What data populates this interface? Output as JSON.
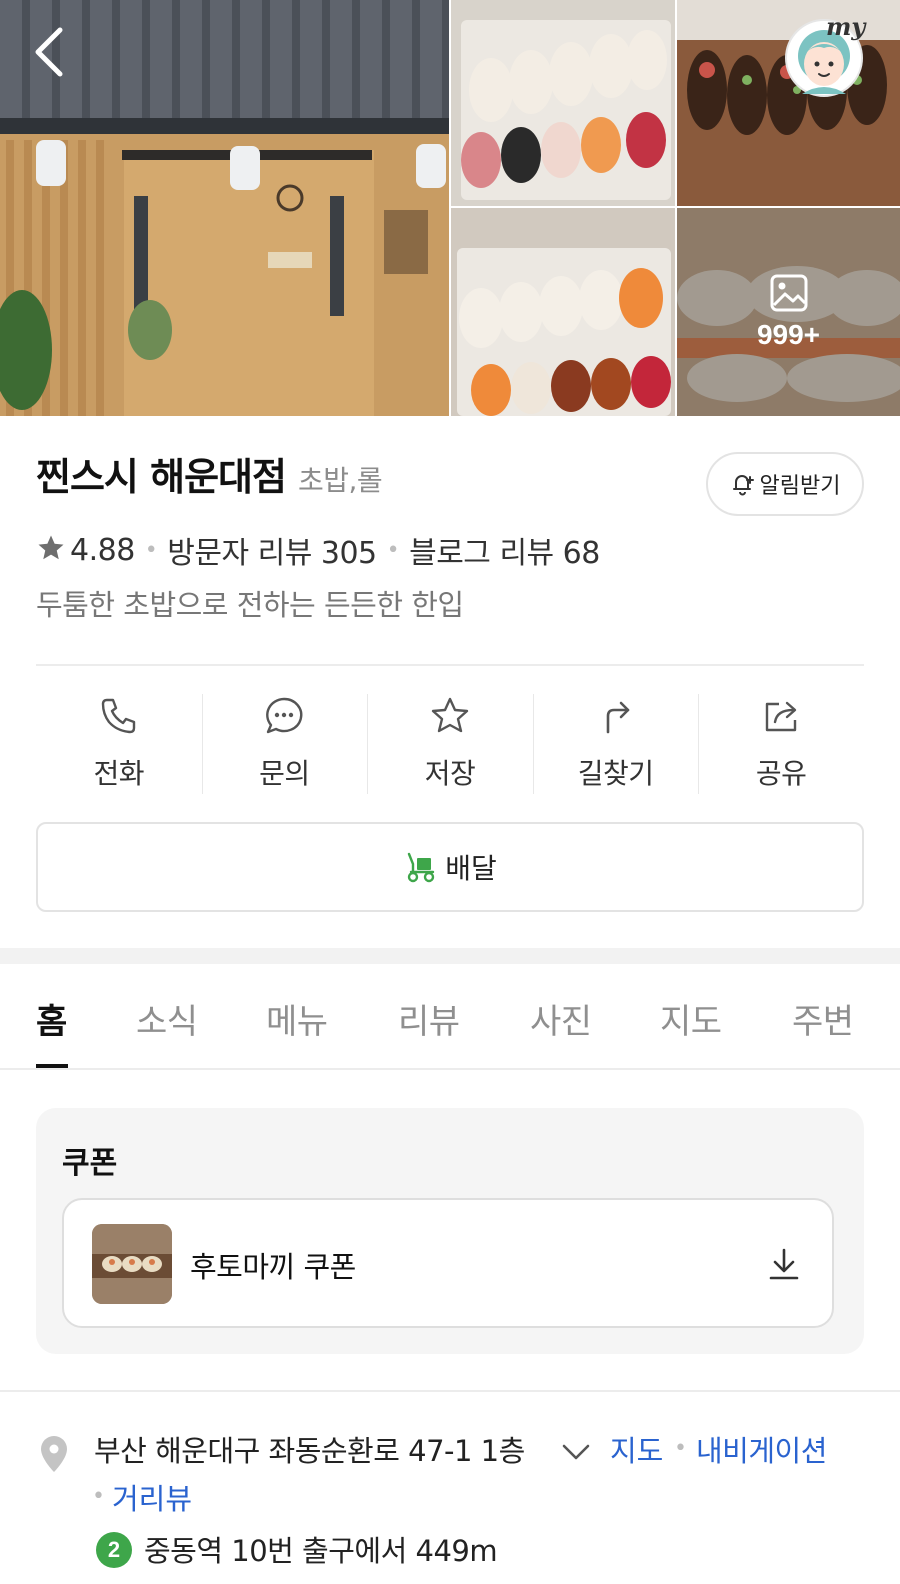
{
  "gallery": {
    "more_count": "999+",
    "photo_icons": [
      "storefront-photo",
      "sushi-photo",
      "grilled-eel-photo",
      "sushi-platter-photo",
      "torched-salmon-photo"
    ]
  },
  "header": {
    "back_icon": "back-arrow-icon",
    "my_icon": "my-avatar-icon",
    "my_badge": "my"
  },
  "place": {
    "name": "찐스시 해운대점",
    "category": "초밥,롤",
    "alarm_label": "알림받기",
    "rating": "4.88",
    "visitor_reviews": "방문자 리뷰 305",
    "blog_reviews": "블로그 리뷰 68",
    "tagline": "두툼한 초밥으로 전하는 든든한 한입"
  },
  "actions": [
    {
      "label": "전화",
      "icon": "phone-icon"
    },
    {
      "label": "문의",
      "icon": "chat-icon"
    },
    {
      "label": "저장",
      "icon": "star-icon"
    },
    {
      "label": "길찾기",
      "icon": "directions-icon"
    },
    {
      "label": "공유",
      "icon": "share-icon"
    }
  ],
  "delivery": {
    "label": "배달",
    "icon": "delivery-scooter-icon",
    "color": "#3ea64a"
  },
  "tabs": [
    "홈",
    "소식",
    "메뉴",
    "리뷰",
    "사진",
    "지도",
    "주변"
  ],
  "active_tab": "홈",
  "coupon": {
    "title": "쿠폰",
    "item_name": "후토마끼 쿠폰"
  },
  "address": {
    "text": "부산 해운대구 좌동순환로 47-1 1층",
    "map_link": "지도",
    "nav_link": "내비게이션",
    "street_link": "거리뷰",
    "subway_line": "2",
    "subway_info": "중동역 10번 출구에서 449m"
  },
  "colors": {
    "link": "#2a63cf",
    "subway_line_2": "#3ea64a",
    "delivery_green": "#3ea64a"
  }
}
